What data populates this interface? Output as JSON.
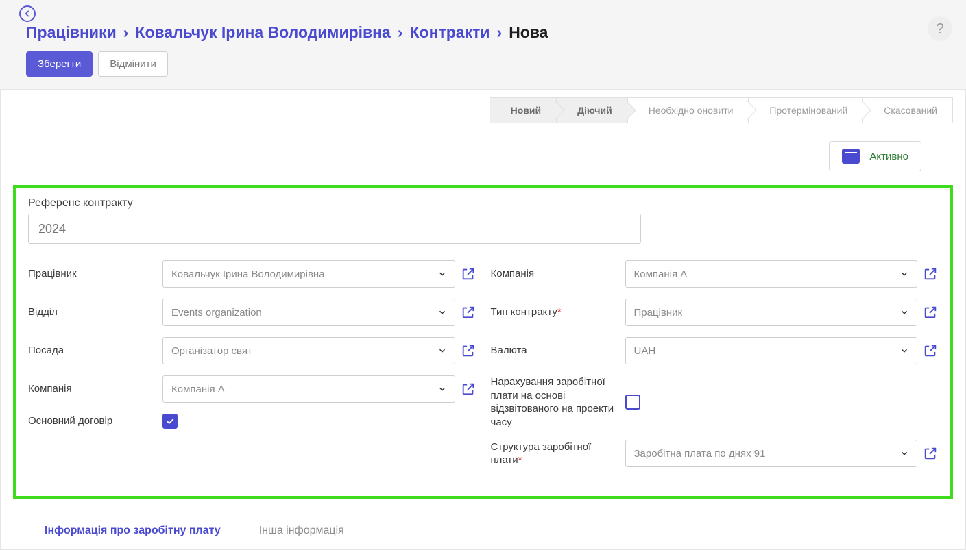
{
  "breadcrumbs": {
    "items": [
      "Працівники",
      "Ковальчук Ірина Володимирівна",
      "Контракти"
    ],
    "current": "Нова",
    "separator": "›"
  },
  "actions": {
    "save": "Зберегти",
    "cancel": "Відмінити"
  },
  "help": "?",
  "status_steps": [
    "Новий",
    "Діючий",
    "Необхідно оновити",
    "Протермінований",
    "Скасований"
  ],
  "active_badge": "Активно",
  "form": {
    "ref_label": "Референс контракту",
    "ref_placeholder": "2024",
    "left": {
      "employee": {
        "label": "Працівник",
        "value": "Ковальчук Ірина Володимирівна"
      },
      "department": {
        "label": "Відділ",
        "value": "Events organization"
      },
      "position": {
        "label": "Посада",
        "value": "Організатор свят"
      },
      "company": {
        "label": "Компанія",
        "value": "Компанія А"
      },
      "main_contract": {
        "label": "Основний договір",
        "checked": true
      }
    },
    "right": {
      "company": {
        "label": "Компанія",
        "value": "Компанія А"
      },
      "contract_type": {
        "label": "Тип контракту",
        "value": "Працівник",
        "required": true
      },
      "currency": {
        "label": "Валюта",
        "value": "UAH"
      },
      "payroll_by_time": {
        "label": "Нарахування заробітної плати на основі відзвітованого на проекти часу",
        "checked": false
      },
      "salary_structure": {
        "label": "Структура заробітної плати",
        "value": "Заробітна плата по днях 91",
        "required": true
      }
    }
  },
  "tabs": {
    "salary_info": "Інформація про заробітну плату",
    "other_info": "Інша інформація"
  }
}
